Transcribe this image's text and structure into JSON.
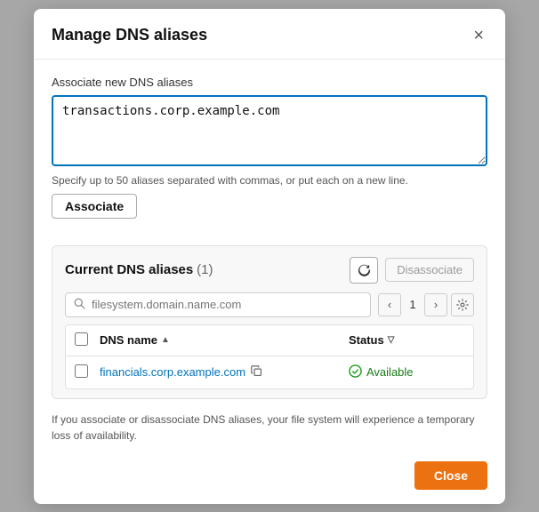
{
  "modal": {
    "title": "Manage DNS aliases",
    "close_label": "×"
  },
  "associate_section": {
    "label": "Associate new DNS aliases",
    "textarea_value": "transactions.corp.example.com",
    "hint": "Specify up to 50 aliases separated with commas, or put each on a new line.",
    "button_label": "Associate"
  },
  "current_aliases": {
    "title": "Current DNS aliases",
    "count": "(1)",
    "disassociate_label": "Disassociate",
    "search_placeholder": "filesystem.domain.name.com",
    "page_number": "1",
    "columns": [
      {
        "label": "DNS name",
        "sortable": true
      },
      {
        "label": "Status",
        "sortable": true
      }
    ],
    "rows": [
      {
        "dns_name": "financials.corp.example.com",
        "status": "Available"
      }
    ]
  },
  "footer": {
    "note": "If you associate or disassociate DNS aliases, your file system will experience a temporary loss of availability.",
    "close_label": "Close"
  }
}
